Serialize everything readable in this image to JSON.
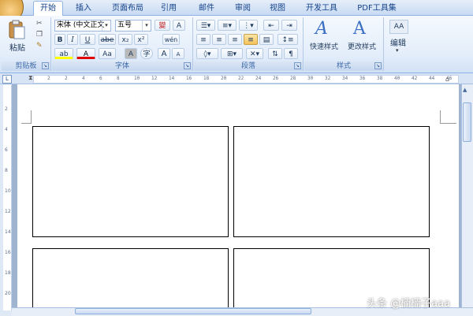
{
  "tabs": [
    "开始",
    "插入",
    "页面布局",
    "引用",
    "邮件",
    "审阅",
    "视图",
    "开发工具",
    "PDF工具集"
  ],
  "active_tab": "开始",
  "clipboard": {
    "paste_label": "粘贴",
    "group_label": "剪贴板"
  },
  "font": {
    "font_name": "宋体 (中文正文",
    "font_size": "五号",
    "group_label": "字体",
    "bold": "B",
    "italic": "I",
    "underline": "U",
    "strike": "abe",
    "subscript": "x₂",
    "superscript": "x²",
    "wen": "變",
    "char_border": "A",
    "highlight": "ab",
    "font_color": "A",
    "case": "Aa",
    "shading": "A",
    "enclose": "字",
    "grow": "A",
    "shrink": "A",
    "phonetic": "wén"
  },
  "paragraph": {
    "group_label": "段落"
  },
  "styles": {
    "quick_styles": "快速样式",
    "change_styles": "更改样式",
    "group_label": "样式",
    "icon_letter": "A"
  },
  "editing": {
    "label": "编辑",
    "icon_letters": "AA"
  },
  "ruler": {
    "h_ticks": [
      "2",
      "2",
      "4",
      "6",
      "8",
      "10",
      "12",
      "14",
      "16",
      "18",
      "20",
      "22",
      "24",
      "26",
      "28",
      "30",
      "32",
      "34",
      "36",
      "38",
      "40",
      "42",
      "44",
      "46"
    ],
    "v_ticks": [
      "2",
      "4",
      "6",
      "8",
      "10",
      "12",
      "14",
      "16",
      "18",
      "20"
    ]
  },
  "watermark": "头条 @楠楠子aaa"
}
